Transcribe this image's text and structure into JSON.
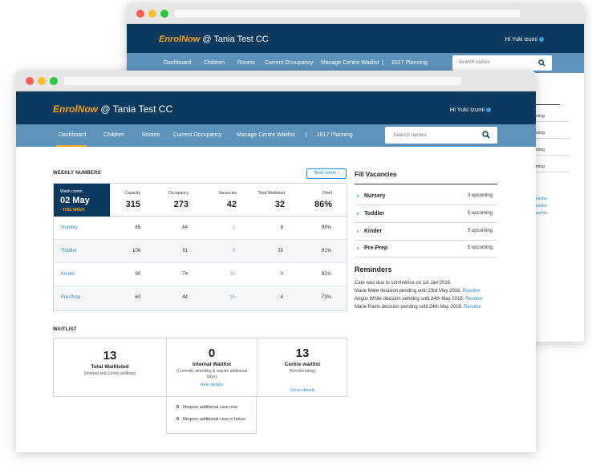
{
  "app": {
    "brand": "EnrolNow",
    "centre": "@ Tania Test CC",
    "greeting": "Hi Yuki Izumi",
    "search_placeholder": "Search names",
    "colors": {
      "header": "#0c3a5f",
      "nav": "#5d93bb",
      "accent": "#f7a21b",
      "link": "#2a8bd0"
    }
  },
  "nav": {
    "items": [
      "Dashboard",
      "Children",
      "Rooms",
      "Current Occupancy",
      "Manage Centre Waitlist",
      "|",
      "2017 Planning"
    ]
  },
  "back_window": {
    "rows": [
      "ming",
      "ming",
      "ming",
      "ming"
    ],
    "links": [
      "esolve",
      "esolve",
      "esolve"
    ]
  },
  "weekly": {
    "title": "WEEKLY NUMBERS",
    "next_week": "Next week ›",
    "week_label": "Week comm.",
    "week_date": "02 May",
    "week_tag": "- THIS WEEK",
    "headers": [
      {
        "label": "Capacity",
        "value": "315"
      },
      {
        "label": "Occupancy",
        "value": "273"
      },
      {
        "label": "Vacancies",
        "value": "42"
      },
      {
        "label": "Total Waitlisted",
        "value": "32"
      },
      {
        "label": "Filled",
        "value": "86%"
      }
    ],
    "rows": [
      {
        "name": "Nursery",
        "values": [
          "65",
          "64",
          "1",
          "8",
          "98%"
        ]
      },
      {
        "name": "Toddler",
        "values": [
          "100",
          "91",
          "9",
          "20",
          "91%"
        ]
      },
      {
        "name": "Kinder",
        "values": [
          "90",
          "74",
          "16",
          "0",
          "82%"
        ]
      },
      {
        "name": "Pre-Prep",
        "values": [
          "60",
          "44",
          "16",
          "4",
          "73%"
        ]
      }
    ]
  },
  "fill_vacancies": {
    "title": "Fill Vacancies",
    "items": [
      {
        "name": "Nursery",
        "upcoming": "3 upcoming"
      },
      {
        "name": "Toddler",
        "upcoming": "5 upcoming"
      },
      {
        "name": "Kinder",
        "upcoming": "5 upcoming"
      },
      {
        "name": "Pre-Prep",
        "upcoming": "5 upcoming"
      }
    ]
  },
  "reminders": {
    "title": "Reminders",
    "items": [
      {
        "text": "Care was due to commence on 1st Jan 2016.",
        "link": ""
      },
      {
        "text": "Marie Mare decision pending until 23rd May 2016.",
        "link": "Resolve"
      },
      {
        "text": "Angus White decision pending until 24th May 2016.",
        "link": "Resolve"
      },
      {
        "text": "Marie Pants decision pending until 24th May 2016.",
        "link": "Resolve"
      }
    ]
  },
  "waitlist": {
    "title": "WAITLIST",
    "total": {
      "count": "13",
      "name": "Total Waitlisted",
      "sub": "(Internal and Centre waitlists)"
    },
    "internal": {
      "count": "0",
      "name": "Internal Waitlist",
      "sub": "(Currently attending & require additional days)",
      "link": "Hide details"
    },
    "centre": {
      "count": "13",
      "name": "Centre waitlist",
      "sub": "(Not Attending)",
      "link": "Show details"
    },
    "details": [
      {
        "count": "0",
        "text": "Require additional care now"
      },
      {
        "count": "0",
        "text": "Require additional care in future"
      }
    ]
  }
}
